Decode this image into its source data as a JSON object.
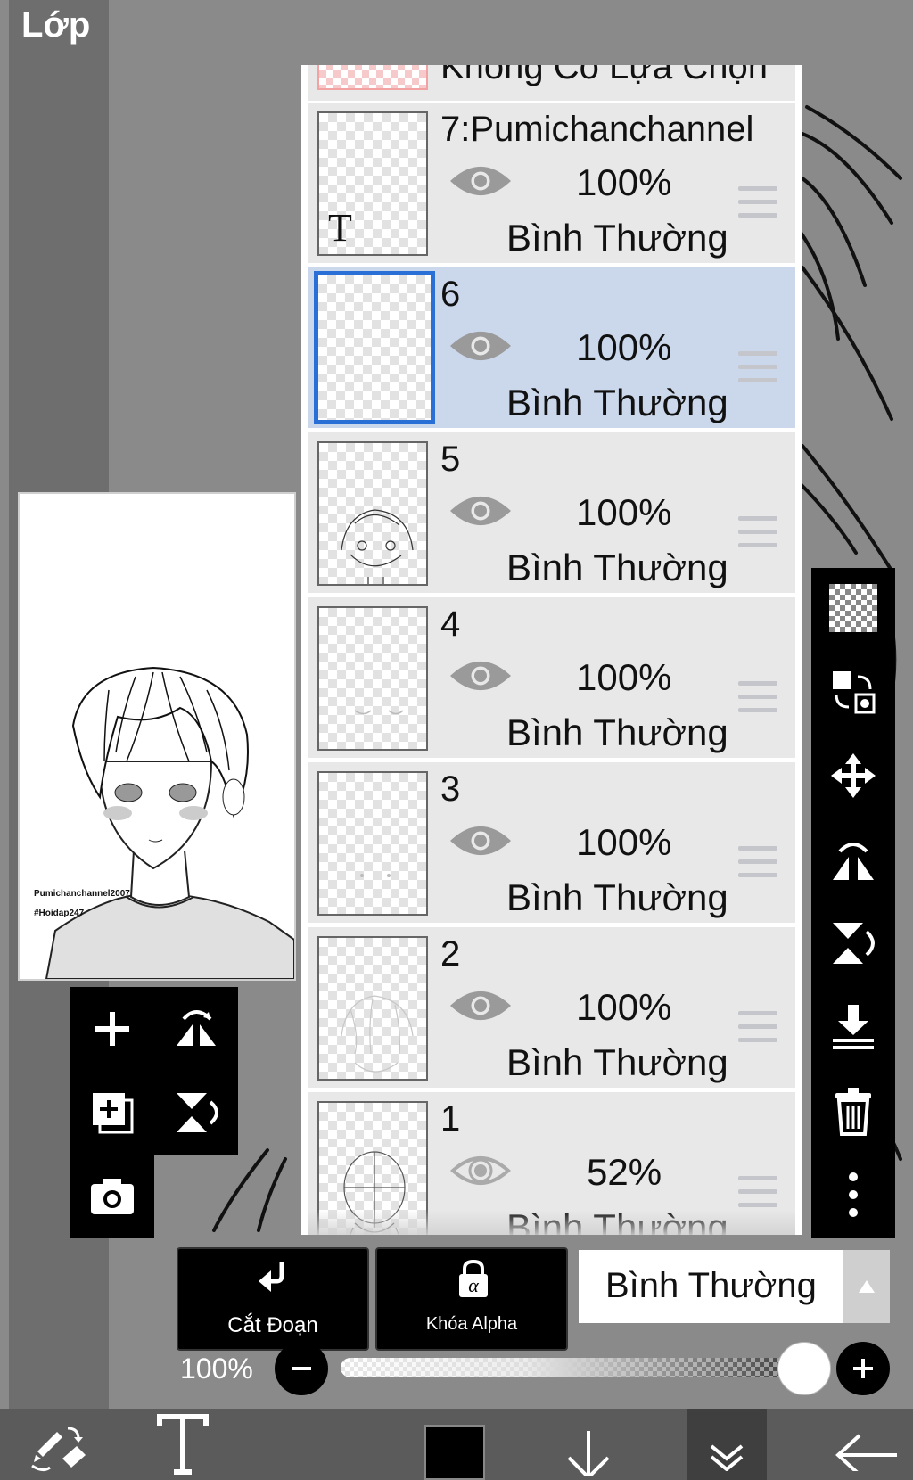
{
  "header": {
    "title": "Lớp"
  },
  "preview": {
    "watermark_line1": "Pumichanchannel2007",
    "watermark_line2": "#Hoidap247"
  },
  "layers": {
    "top_partial_label": "Không Có Lựa Chọn",
    "items": [
      {
        "name": "7:Pumichanchannel",
        "opacity": "100%",
        "blend": "Bình Thường",
        "type": "text",
        "visible": true,
        "selected": false,
        "text_icon": "T"
      },
      {
        "name": "6",
        "opacity": "100%",
        "blend": "Bình Thường",
        "type": "raster",
        "visible": true,
        "selected": true
      },
      {
        "name": "5",
        "opacity": "100%",
        "blend": "Bình Thường",
        "type": "raster",
        "visible": true,
        "selected": false
      },
      {
        "name": "4",
        "opacity": "100%",
        "blend": "Bình Thường",
        "type": "raster",
        "visible": true,
        "selected": false
      },
      {
        "name": "3",
        "opacity": "100%",
        "blend": "Bình Thường",
        "type": "raster",
        "visible": true,
        "selected": false
      },
      {
        "name": "2",
        "opacity": "100%",
        "blend": "Bình Thường",
        "type": "raster",
        "visible": true,
        "selected": false
      },
      {
        "name": "1",
        "opacity": "52%",
        "blend": "Bình Thường",
        "type": "raster",
        "visible": true,
        "selected": false
      }
    ]
  },
  "left_tools": [
    "plus-icon",
    "flip-horizontal-icon",
    "add-layer-icon",
    "flip-vertical-icon",
    "camera-icon"
  ],
  "right_tools": [
    "transparent-grid-icon",
    "swap-icon",
    "move-icon",
    "flip-h-icon",
    "flip-v-icon",
    "merge-down-icon",
    "trash-icon",
    "more-icon"
  ],
  "bottom_controls": {
    "clip_label": "Cắt Đoạn",
    "alpha_label": "Khóa Alpha",
    "alpha_glyph": "α",
    "blend_mode": "Bình Thường",
    "opacity_label": "100%",
    "opacity_value": 1.0
  },
  "bottom_toolbar": [
    "brush-eraser-swap-icon",
    "text-tool-icon",
    "color-swatch",
    "arrow-down-icon",
    "collapse-icon",
    "back-arrow-icon"
  ],
  "colors": {
    "selection": "#cbd8ec",
    "accent": "#2a6fd6",
    "panel": "#e8e8e8"
  }
}
